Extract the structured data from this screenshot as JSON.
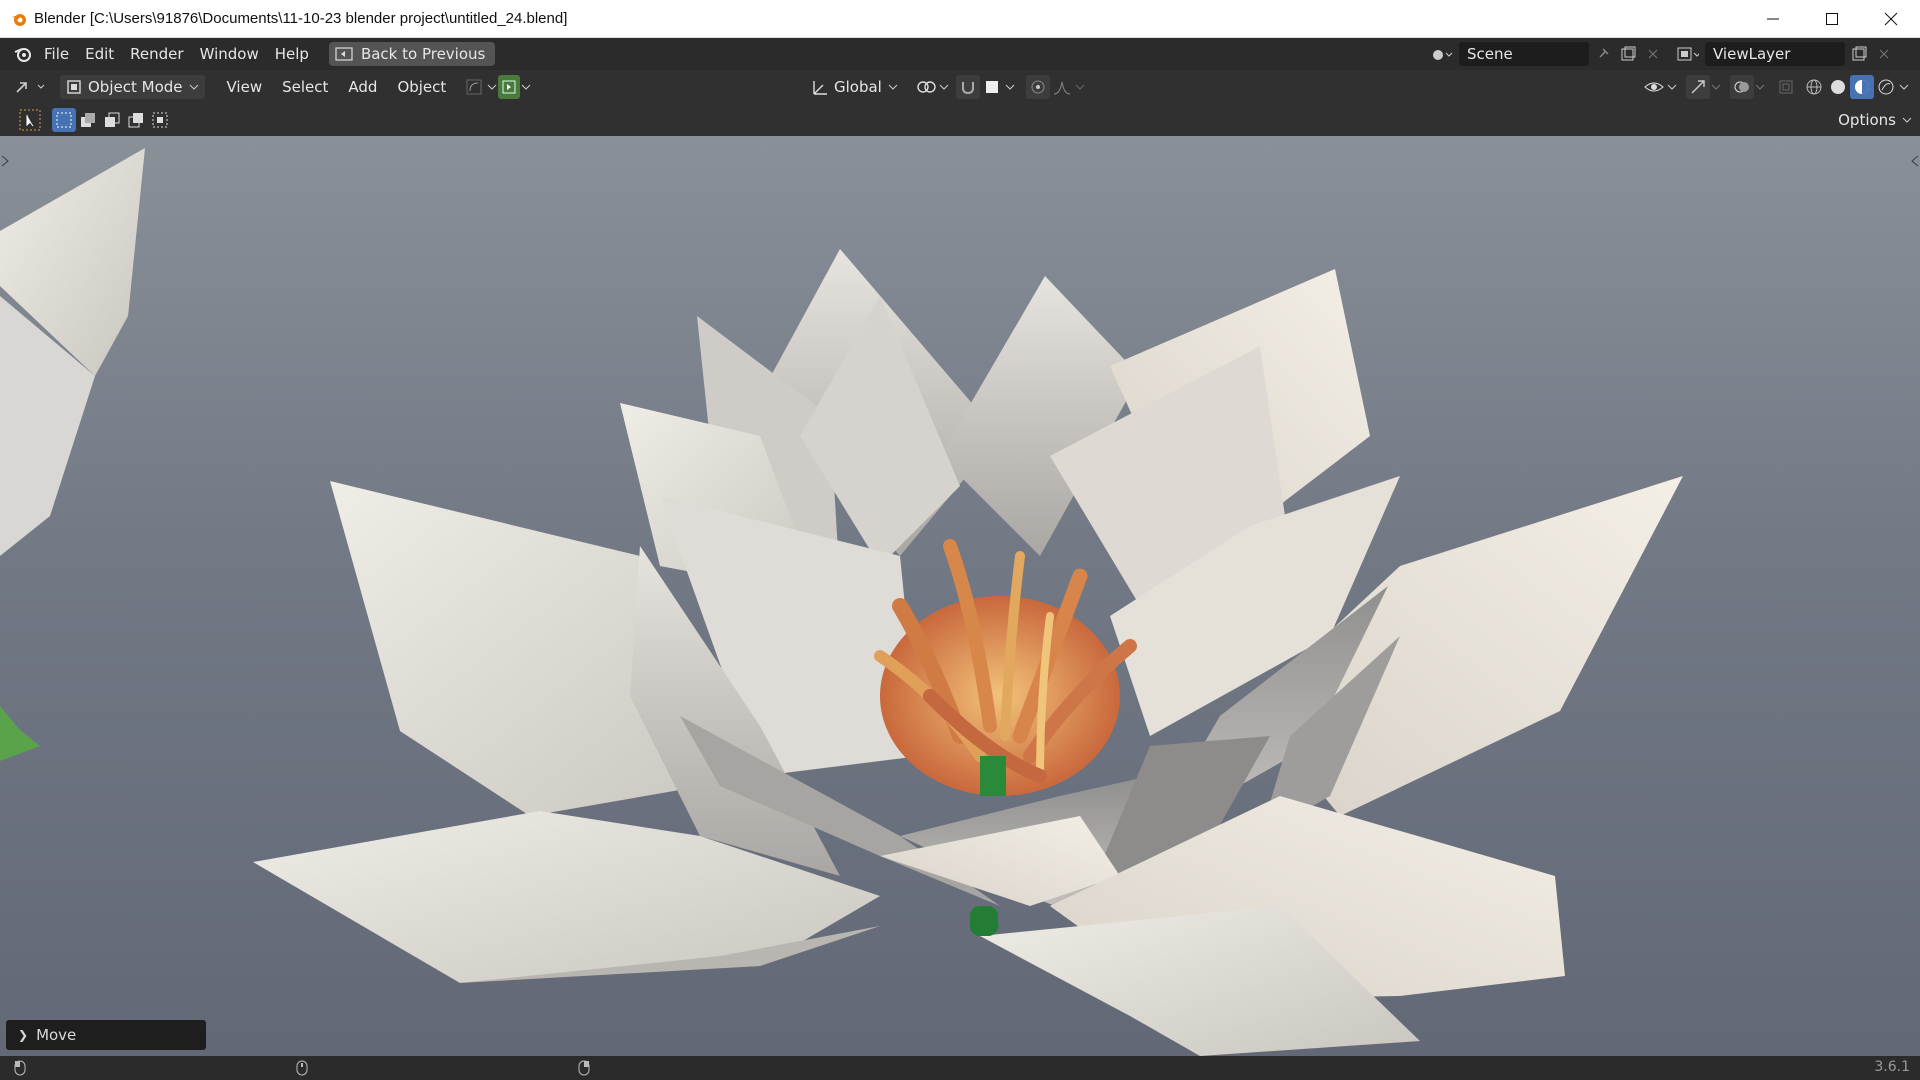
{
  "window": {
    "title": "Blender [C:\\Users\\91876\\Documents\\11-10-23 blender project\\untitled_24.blend]",
    "controls": [
      "minimize-icon",
      "maximize-icon",
      "close-icon"
    ]
  },
  "topbar": {
    "menus": [
      "File",
      "Edit",
      "Render",
      "Window",
      "Help"
    ],
    "back_button": "Back to Previous",
    "scene": "Scene",
    "view_layer": "ViewLayer"
  },
  "viewport_header": {
    "mode": "Object Mode",
    "menus": [
      "View",
      "Select",
      "Add",
      "Object"
    ],
    "orientation": "Global"
  },
  "tool_row": {
    "options": "Options"
  },
  "operator_panel": {
    "label": "Move"
  },
  "statusbar": {
    "version": "3.6.1"
  },
  "colors": {
    "accent_blue": "#4772b3",
    "panel": "#303030",
    "topbar": "#2b2b2b",
    "viewport_top": "#8a9098",
    "viewport_bottom": "#626876"
  }
}
